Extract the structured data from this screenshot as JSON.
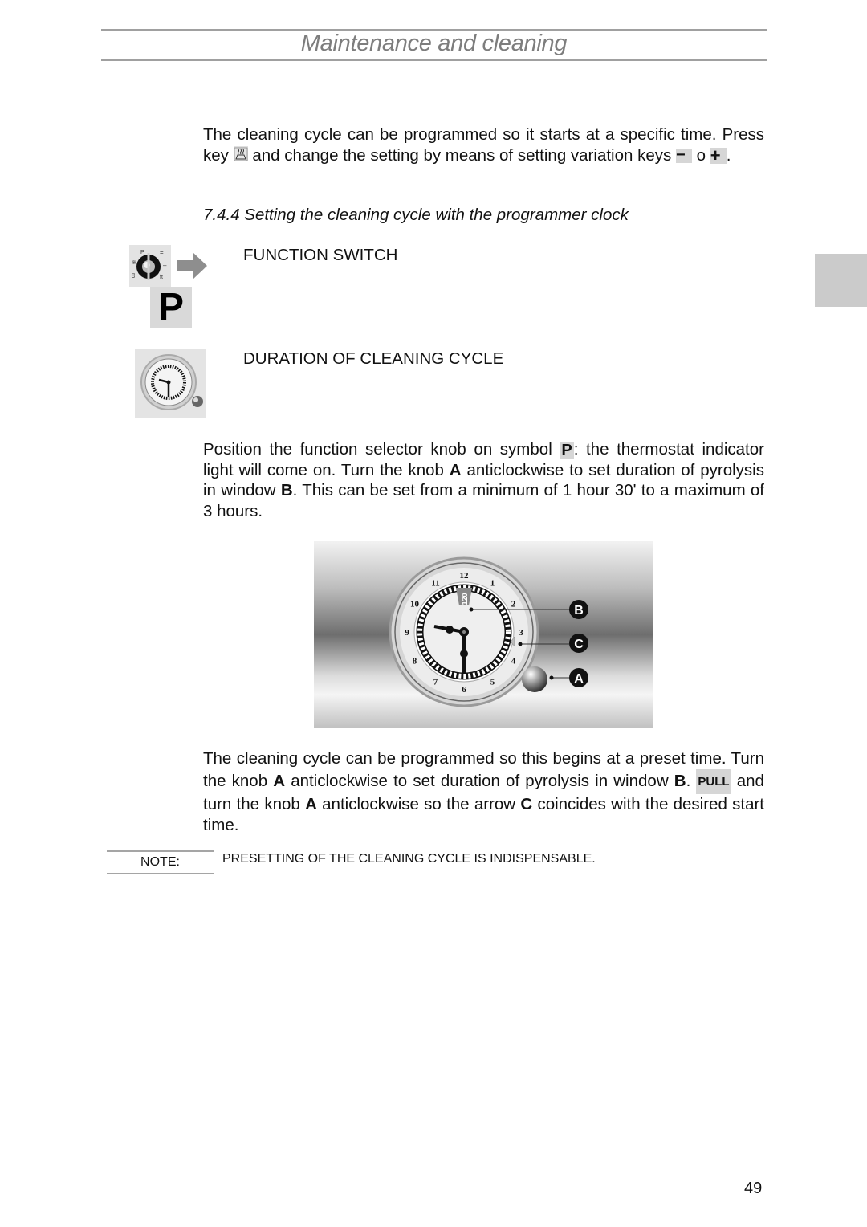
{
  "header": {
    "title": "Maintenance and cleaning"
  },
  "intro": {
    "line1": "The cleaning cycle can be programmed so it starts at a specific time.",
    "press_key": "Press key",
    "after_key": "and change the setting by means of setting variation keys",
    "minus_key": "−",
    "or": "o",
    "plus_key": "+",
    "end": "."
  },
  "section": {
    "heading": "7.4.4 Setting the cleaning cycle with the programmer clock"
  },
  "controls": {
    "function_switch_label": "FUNCTION SWITCH",
    "function_symbol": "P",
    "duration_label": "DURATION OF CLEANING CYCLE"
  },
  "position_paragraph": {
    "part1": "Position the function selector knob on symbol",
    "symbol": "P",
    "part2": ": the thermostat indicator light will come on. Turn the knob",
    "knob": "A",
    "part3": "anticlockwise to set duration of pyrolysis in window",
    "window": "B",
    "part4": ". This can be set from a minimum of 1 hour 30' to a maximum of 3 hours."
  },
  "clock_diagram": {
    "numerals": [
      "12",
      "1",
      "2",
      "3",
      "4",
      "5",
      "6",
      "7",
      "8",
      "9",
      "10",
      "11"
    ],
    "window_value": "120",
    "callouts": [
      "B",
      "C",
      "A"
    ]
  },
  "preset_paragraph": {
    "part1": "The cleaning cycle can be programmed so this begins at a preset time. Turn the knob",
    "knob1": "A",
    "part2": "anticlockwise to set duration of pyrolysis in window",
    "window": "B",
    "part3": ".",
    "pull_key": "PULL",
    "part4": "and turn the knob",
    "knob2": "A",
    "part5": "anticlockwise so the arrow",
    "arrow": "C",
    "part6": "coincides with the desired start time."
  },
  "note": {
    "label": "NOTE:",
    "text": "PRESETTING OF THE CLEANING CYCLE IS INDISPENSABLE."
  },
  "footer": {
    "page_number": "49"
  }
}
